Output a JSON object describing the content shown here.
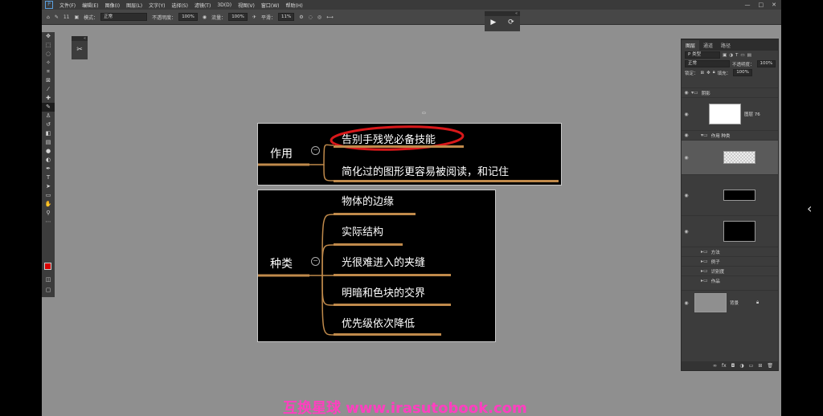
{
  "app": {
    "menu": [
      "文件(F)",
      "编辑(E)",
      "图像(I)",
      "图层(L)",
      "文字(Y)",
      "选择(S)",
      "滤镜(T)",
      "3D(D)",
      "视图(V)",
      "窗口(W)",
      "帮助(H)"
    ],
    "window_controls": [
      "—",
      "□",
      "✕"
    ]
  },
  "options": {
    "mode_label": "模式：",
    "mode_value": "正常",
    "opacity_label": "不透明度：",
    "opacity_value": "100%",
    "flow_label": "流量：",
    "flow_value": "100%",
    "smooth_label": "平滑：",
    "smooth_value": "11%",
    "brush_size": "11"
  },
  "mindmap1": {
    "root": "作用",
    "branches": [
      "告别手残党必备技能",
      "简化过的图形更容易被阅读，和记住"
    ]
  },
  "mindmap2": {
    "root": "种类",
    "branches": [
      "物体的边缘",
      "实际结构",
      "光很难进入的夹缝",
      "明暗和色块的交界",
      "优先级依次降低"
    ]
  },
  "layers_panel": {
    "tabs": [
      "图层",
      "通道",
      "路径"
    ],
    "filter_value": "P 类型",
    "blend_value": "正常",
    "opacity_label": "不透明度：",
    "opacity_value": "100%",
    "lock_label": "锁定：",
    "fill_label": "填充：",
    "fill_value": "100%",
    "layers": [
      {
        "name": "阴影"
      },
      {
        "name": "图层 76"
      },
      {
        "name": "作用 种类"
      },
      {
        "name": ""
      },
      {
        "name": ""
      },
      {
        "name": ""
      },
      {
        "name": "方法"
      },
      {
        "name": "例子"
      },
      {
        "name": "识别度"
      },
      {
        "name": "作品"
      },
      {
        "name": "背景"
      }
    ]
  },
  "watermark": "互换星球 www.irasutobook.com",
  "colors": {
    "accent_underline": "#c08a4b",
    "highlight_circle": "#d8181a",
    "watermark": "#ff3fc0"
  }
}
